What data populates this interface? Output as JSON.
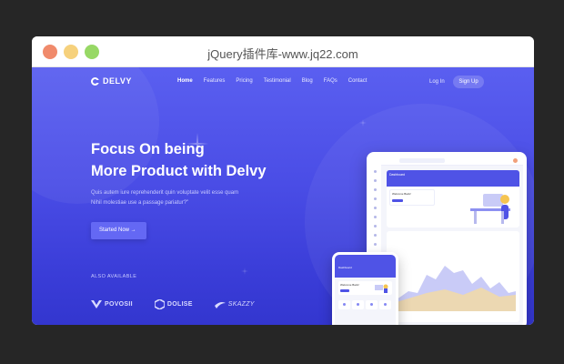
{
  "window": {
    "title": "jQuery插件库-www.jq22.com"
  },
  "nav": {
    "brand": "DELVY",
    "items": [
      {
        "label": "Home",
        "active": true
      },
      {
        "label": "Features",
        "active": false
      },
      {
        "label": "Pricing",
        "active": false
      },
      {
        "label": "Testimonial",
        "active": false
      },
      {
        "label": "Blog",
        "active": false
      },
      {
        "label": "FAQs",
        "active": false
      },
      {
        "label": "Contact",
        "active": false
      }
    ],
    "login": "Log In",
    "signup": "Sign Up"
  },
  "hero": {
    "headline_line1": "Focus On being",
    "headline_line2": "More Product with Delvy",
    "subtext_line1": "Quis autem iure reprehenderit quin voluptate velit esse quam",
    "subtext_line2": "Nihil molestiae use a passage pariatur?\"",
    "cta": "Started Now →"
  },
  "also_available": {
    "label": "ALSO AVAILABLE",
    "brands": [
      "POVOSII",
      "DOLISE",
      "SKAZZY"
    ]
  },
  "mockup": {
    "tablet_title": "Dashboard",
    "tablet_card_title": "Welcome Back!",
    "phone_title": "Dashboard",
    "phone_card_title": "Welcome Back!"
  },
  "watermark": "jQuery",
  "colors": {
    "primary": "#4f53e6",
    "accent": "#f5c451",
    "chart_fill": "#c9cbf7"
  }
}
